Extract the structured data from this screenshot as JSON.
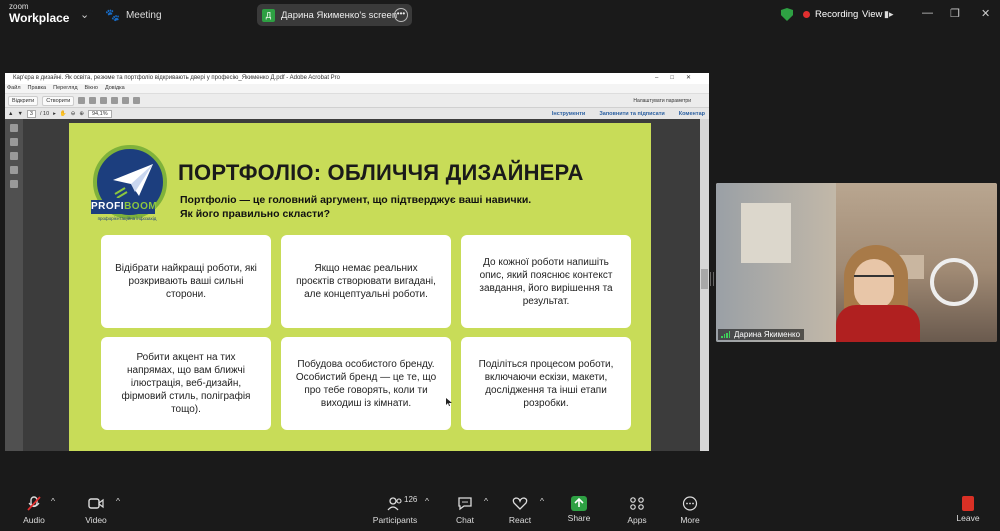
{
  "app": {
    "logo_line1": "zoom",
    "logo_line2": "Workplace",
    "meeting_label": "Meeting"
  },
  "screen_share": {
    "avatar_letter": "Д",
    "label": "Дарина Якименко's screen"
  },
  "status": {
    "recording_label": "Recording",
    "view_label": "View"
  },
  "acrobat": {
    "title": "Кар'єра в дизайні. Як освіта, резюме та портфоліо відкривають двері у професію_Якименко Д.pdf - Adobe Acrobat Pro",
    "menu": [
      "Файл",
      "Правка",
      "Перегляд",
      "Вікно",
      "Довідка"
    ],
    "open_label": "Відкрити",
    "create_label": "Створити",
    "customize_label": "Налаштувати параметри",
    "page_current": "3",
    "page_total": "/ 10",
    "zoom": "94,1%",
    "tabs": [
      "Інструменти",
      "Заповнити та підписати",
      "Коментар"
    ]
  },
  "slide": {
    "brand_main": "PROFI",
    "brand_accent": "BOOM",
    "brand_sub": "профорієнтаційна інфозахід",
    "heading": "ПОРТФОЛІО: ОБЛИЧЧЯ ДИЗАЙНЕРА",
    "subheading": "Портфоліо — це головний аргумент, що підтверджує ваші навички. Як його правильно скласти?",
    "cards": [
      "Відібрати найкращі роботи, які розкривають ваші сильні сторони.",
      "Якщо немає реальних проєктів створювати вигадані, але концептуальні роботи.",
      "До кожної роботи напишіть опис, який пояснює контекст завдання, його вирішення та результат.",
      "Робити акцент на тих напрямах, що вам ближчі ілюстрація, веб-дизайн, фірмовий стиль, поліграфія тощо).",
      "Побудова особистого бренду. Особистий бренд — це те, що про тебе говорять, коли ти виходиш із кімнати.",
      "Поділіться процесом роботи, включаючи ескізи, макети, дослідження та інші етапи розробки."
    ]
  },
  "video": {
    "participant_name": "Дарина Якименко"
  },
  "toolbar": {
    "audio": "Audio",
    "video": "Video",
    "participants": "Participants",
    "participants_count": "126",
    "chat": "Chat",
    "react": "React",
    "share": "Share",
    "apps": "Apps",
    "more": "More",
    "leave": "Leave"
  },
  "colors": {
    "slide_bg": "#c8dc58",
    "brand_navy": "#1c3e7e",
    "brand_green": "#8cc63f",
    "recording": "#e02f2f",
    "share": "#2ea043",
    "leave": "#d93025"
  }
}
